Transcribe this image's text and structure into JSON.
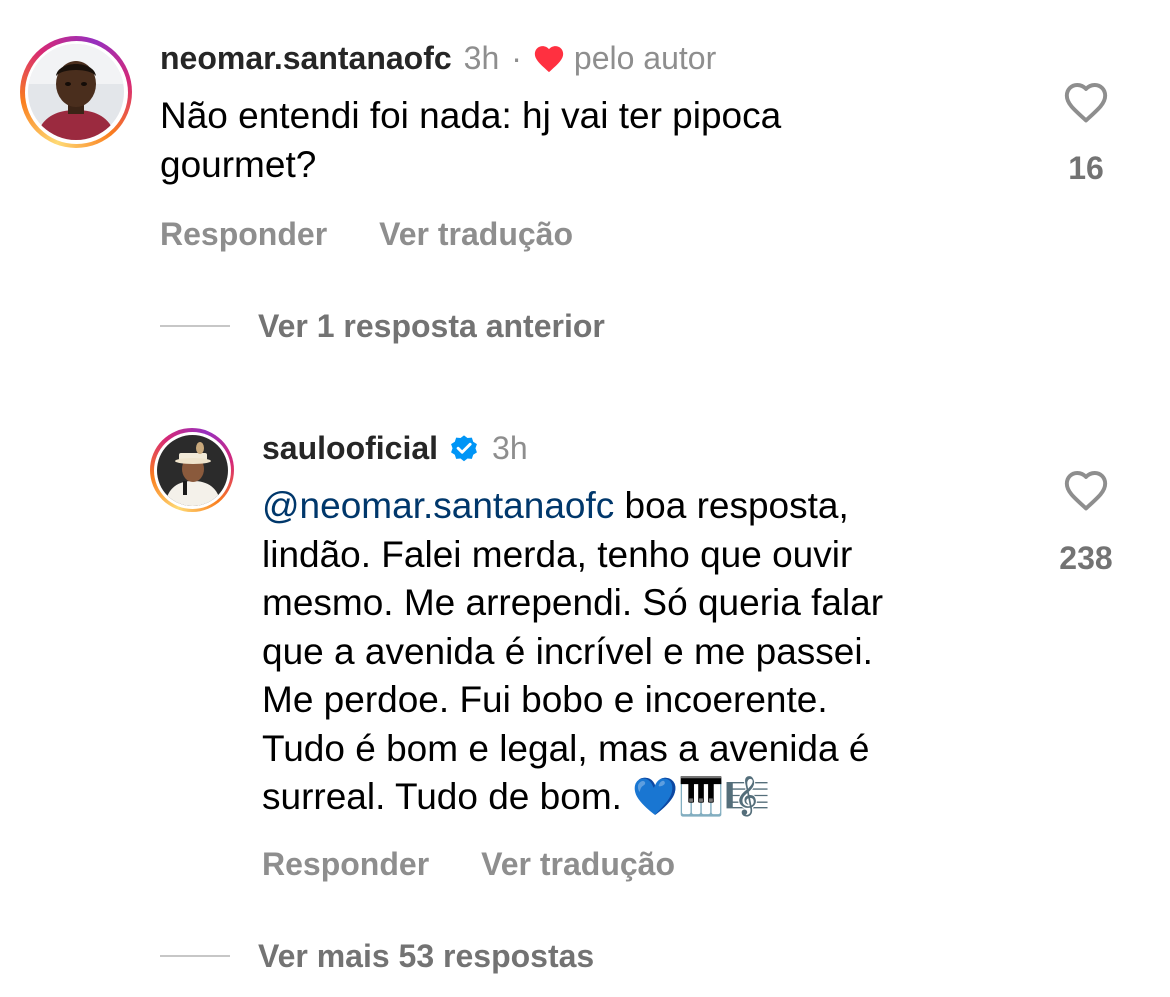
{
  "comments": [
    {
      "username": "neomar.santanaofc",
      "time": "3h",
      "separator": "·",
      "liked_by_author_label": "pelo autor",
      "text": "Não entendi foi nada: hj vai ter pipoca\ngourmet?",
      "likes": "16",
      "reply_label": "Responder",
      "translate_label": "Ver tradução"
    },
    {
      "username": "saulooficial",
      "verified": true,
      "time": "3h",
      "mention": "@neomar.santanaofc",
      "text_first_line": " boa resposta,",
      "text_rest": "lindão. Falei merda, tenho que ouvir\nmesmo. Me arrependi. Só queria falar\nque a avenida é incrível e me passei.\nMe perdoe. Fui bobo e incoerente.\nTudo é bom e legal, mas a avenida é\nsurreal. Tudo de bom. 💙🎹🎼",
      "likes": "238",
      "reply_label": "Responder",
      "translate_label": "Ver tradução"
    }
  ],
  "threads": {
    "previous_replies": "Ver 1 resposta anterior",
    "more_replies": "Ver mais 53 respostas"
  },
  "colors": {
    "heart_liked": "#ff3040",
    "verified_badge": "#0095f6",
    "mention": "#00376b",
    "muted_text": "#8e8e8e"
  }
}
